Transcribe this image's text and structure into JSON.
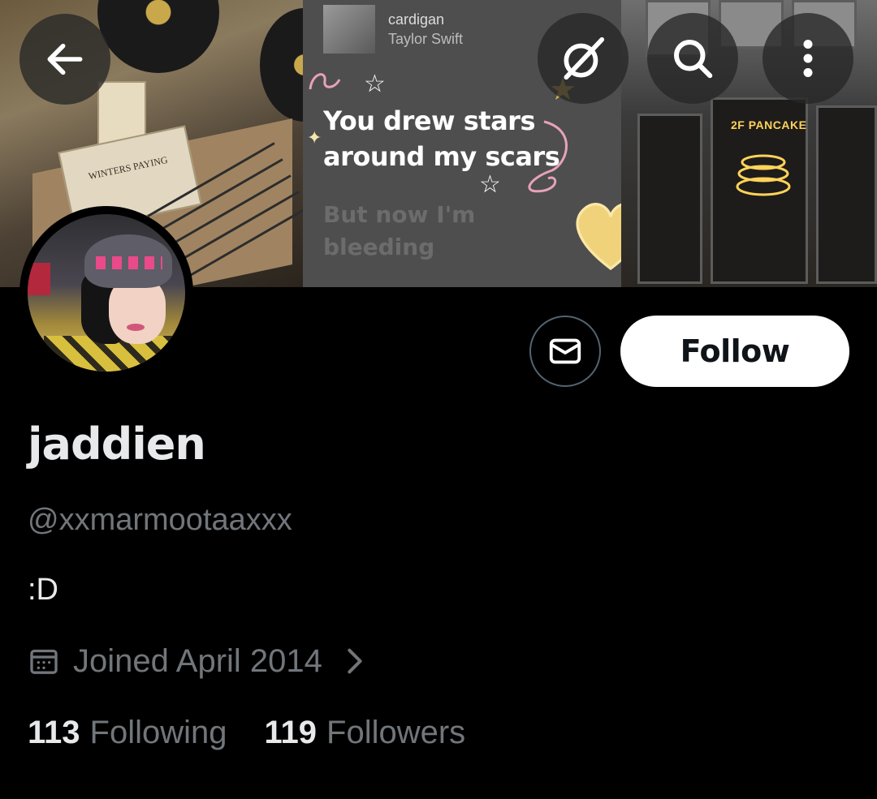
{
  "banner": {
    "song_title": "cardigan",
    "song_artist": "Taylor Swift",
    "lyric_active_line1": "You drew stars",
    "lyric_active_line2": "around my scars",
    "lyric_next_line1": "But now I'm",
    "lyric_next_line2": "bleeding",
    "record_label_1": "WINTERS PAYING",
    "neon_sign_text": "2F PANCAKE"
  },
  "top_bar": {
    "back_icon": "arrow-left-icon",
    "grok_icon": "grok-icon",
    "search_icon": "search-icon",
    "more_icon": "more-vertical-icon"
  },
  "actions": {
    "message_icon": "envelope-icon",
    "follow_label": "Follow"
  },
  "profile": {
    "display_name": "jaddien",
    "handle": "@xxmarmootaaxxx",
    "bio": ":D",
    "joined": "Joined April 2014",
    "following_count": "113",
    "following_label": "Following",
    "followers_count": "119",
    "followers_label": "Followers"
  },
  "colors": {
    "background": "#000000",
    "primary_text": "#e7e9ea",
    "secondary_text": "#71767b",
    "follow_button_bg": "#ffffff",
    "follow_button_text": "#0f1419"
  }
}
